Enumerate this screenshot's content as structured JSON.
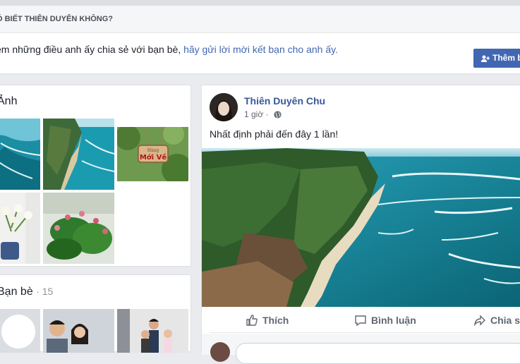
{
  "know_section": {
    "title": "Ó BIẾT THIÊN DUYÊN KHÔNG?",
    "text": "em những điều anh ấy chia sẻ với bạn bè,",
    "link": "hãy gửi lời mời kết bạn cho anh ấy.",
    "add_button": "Thêm b"
  },
  "photos": {
    "title": "Ảnh"
  },
  "friends": {
    "title": "Bạn bè",
    "count": "· 15"
  },
  "post": {
    "author": "Thiên Duyên Chu",
    "time": "1 giờ",
    "text": "Nhất định phải đến đây 1 lần!",
    "actions": {
      "like": "Thích",
      "comment": "Bình luận",
      "share": "Chia sẻ"
    }
  },
  "sign": {
    "line1": "Hàng",
    "line2": "Mới Về"
  },
  "colors": {
    "link": "#4267b2",
    "author": "#385898",
    "sea": "#0f7b8c"
  }
}
